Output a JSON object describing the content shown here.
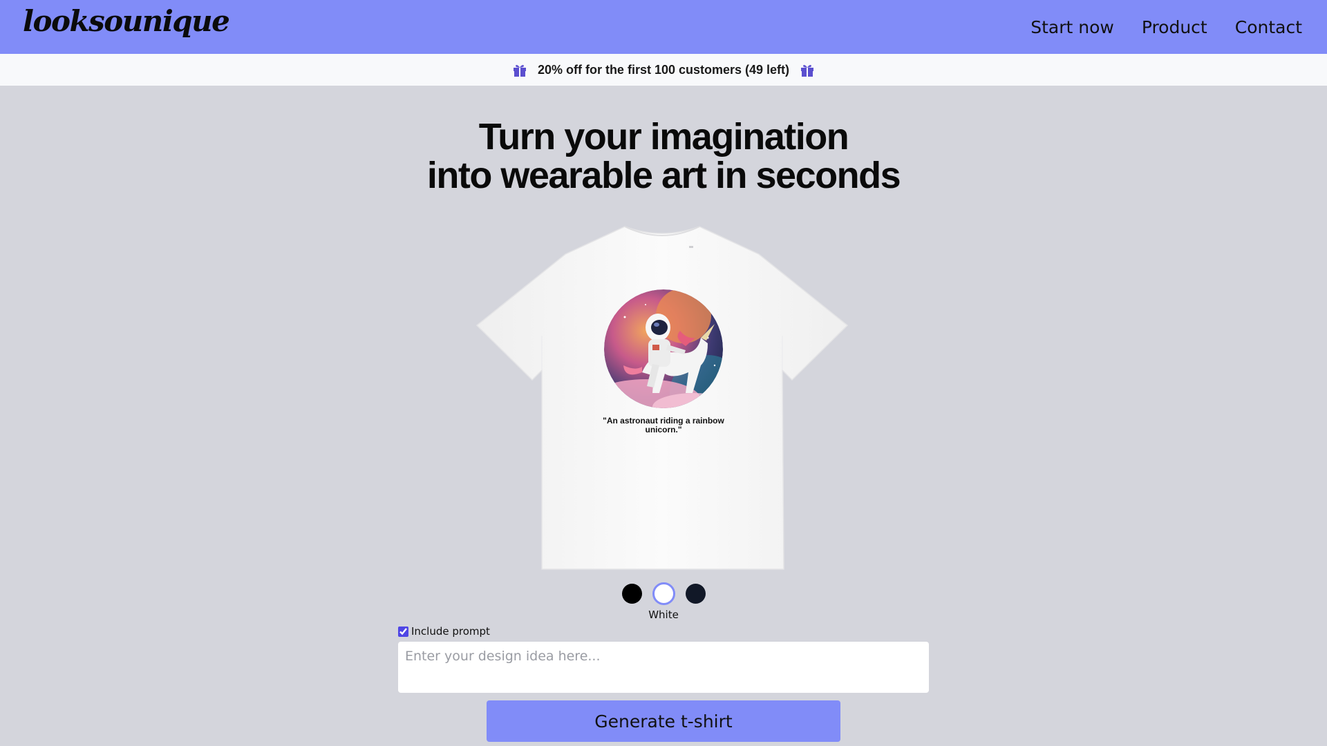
{
  "brand": {
    "logo_text": "looksounique"
  },
  "nav": {
    "items": [
      {
        "label": "Start now"
      },
      {
        "label": "Product"
      },
      {
        "label": "Contact"
      }
    ]
  },
  "promo": {
    "text": "20% off for the first 100 customers (49 left)",
    "icon": "gift-icon",
    "icon_color": "#5b4fcf"
  },
  "hero": {
    "line1": "Turn your imagination",
    "line2": "into wearable art in seconds"
  },
  "product": {
    "image": "white-tshirt-with-astronaut-unicorn-print",
    "caption": "\"An astronaut riding a rainbow unicorn.\""
  },
  "colors": {
    "swatches": [
      {
        "name": "black",
        "hex": "#000000"
      },
      {
        "name": "white",
        "hex": "#ffffff",
        "selected": true
      },
      {
        "name": "navy",
        "hex": "#111827"
      }
    ],
    "selected_label": "White"
  },
  "form": {
    "include_prompt_label": "Include prompt",
    "include_prompt_checked": true,
    "prompt_value": "",
    "prompt_placeholder": "Enter your design idea here...",
    "generate_label": "Generate t-shirt"
  },
  "theme": {
    "accent": "#818cf8",
    "background": "#d4d5dc"
  }
}
